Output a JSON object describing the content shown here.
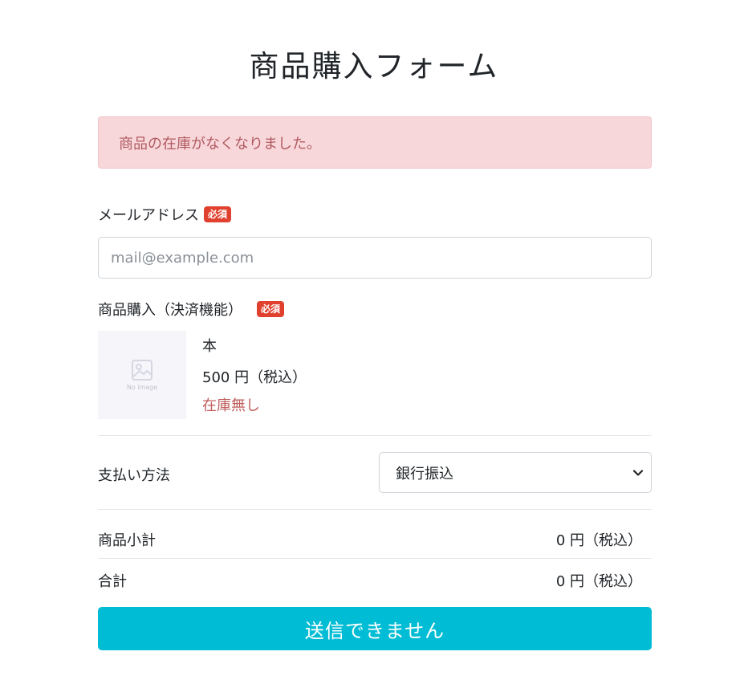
{
  "title": "商品購入フォーム",
  "alert": {
    "message": "商品の在庫がなくなりました。"
  },
  "email": {
    "label": "メールアドレス",
    "required_badge": "必須",
    "placeholder": "mail@example.com",
    "value": ""
  },
  "product_section": {
    "label": "商品購入（決済機能）",
    "required_badge": "必須",
    "image_caption": "No image",
    "image_icon": "image-placeholder-icon",
    "name": "本",
    "price": "500 円（税込）",
    "stock_status": "在庫無し"
  },
  "payment": {
    "label": "支払い方法",
    "selected": "銀行振込",
    "dropdown_icon": "chevron-down-icon"
  },
  "summary": {
    "subtotal_label": "商品小計",
    "subtotal_value": "0 円（税込）",
    "total_label": "合計",
    "total_value": "0 円（税込）"
  },
  "submit": {
    "label": "送信できません"
  },
  "colors": {
    "alert_bg": "#f8d7da",
    "alert_text": "#b05a60",
    "badge": "#e0412f",
    "stock_text": "#c05c5c",
    "submit_bg": "#00bcd4"
  }
}
